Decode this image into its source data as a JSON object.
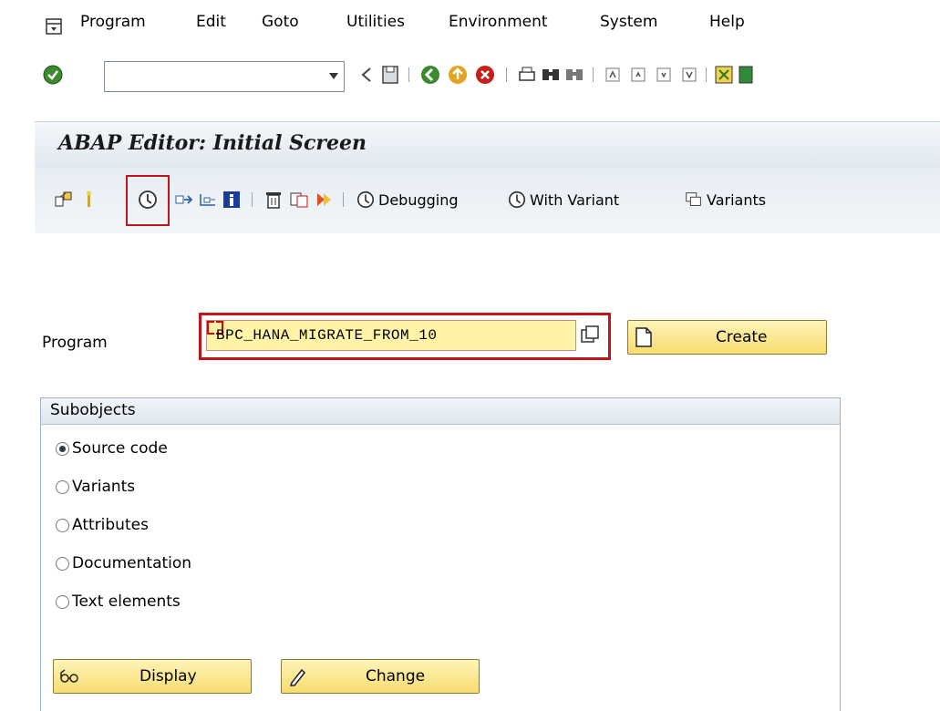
{
  "menubar": {
    "items": [
      "Program",
      "Edit",
      "Goto",
      "Utilities",
      "Environment",
      "System",
      "Help"
    ]
  },
  "system_toolbar": {
    "command_field_value": ""
  },
  "title": "ABAP Editor: Initial Screen",
  "app_toolbar": {
    "debugging_label": "Debugging",
    "with_variant_label": "With Variant",
    "variants_label": "Variants"
  },
  "program": {
    "label": "Program",
    "value": "BPC_HANA_MIGRATE_FROM_10",
    "create_label": "Create"
  },
  "subobjects": {
    "title": "Subobjects",
    "options": [
      {
        "label": "Source code",
        "checked": true
      },
      {
        "label": "Variants",
        "checked": false
      },
      {
        "label": "Attributes",
        "checked": false
      },
      {
        "label": "Documentation",
        "checked": false
      },
      {
        "label": "Text elements",
        "checked": false
      }
    ]
  },
  "buttons": {
    "display_label": "Display",
    "change_label": "Change"
  },
  "colors": {
    "highlight": "#c0151b",
    "button_yellow": "#f7dc6f",
    "field_yellow": "#fff3a8"
  }
}
